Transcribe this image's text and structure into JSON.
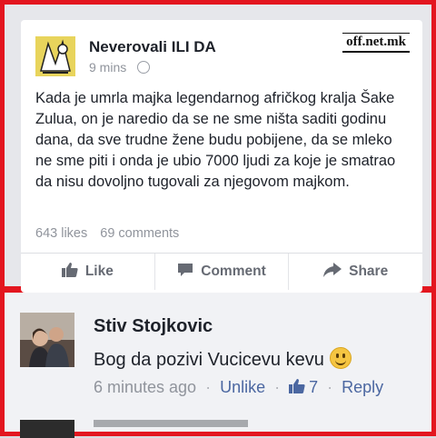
{
  "post": {
    "page_name": "Neverovali ILI DA",
    "time": "9 mins",
    "watermark": "off.net.mk",
    "text": "Kada je umrla majka legendarnog afričkog kralja Šake Zulua, on je naredio da se ne sme ništa saditi godinu dana, da sve trudne žene budu pobijene, da se mleko ne sme piti i onda je ubio 7000 ljudi za koje je smatrao da nisu dovoljno tugovali za njegovom majkom.",
    "likes": "643 likes",
    "comments": "69 comments",
    "actions": {
      "like": "Like",
      "comment": "Comment",
      "share": "Share"
    }
  },
  "comment": {
    "author": "Stiv Stojkovic",
    "text": "Bog da pozivi Vucicevu kevu",
    "time": "6 minutes ago",
    "unlike": "Unlike",
    "like_count": "7",
    "reply": "Reply"
  },
  "colors": {
    "frame": "#e3161f",
    "link": "#4b67a1",
    "muted": "#90949c"
  }
}
